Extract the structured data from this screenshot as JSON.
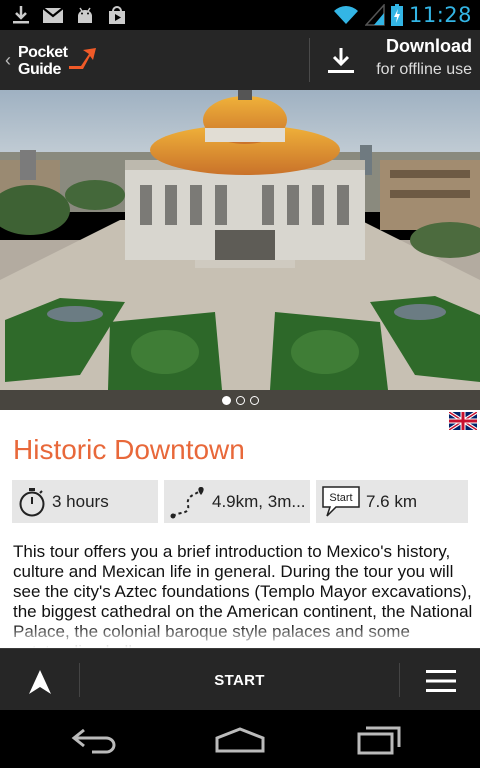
{
  "status_bar": {
    "time": "11:28",
    "left_icons": [
      "download-icon",
      "gmail-icon",
      "android-icon",
      "play-store-icon"
    ],
    "right_icons": [
      "wifi-icon",
      "signal-icon",
      "battery-icon"
    ],
    "accent_color": "#33b5e5"
  },
  "app_bar": {
    "logo_line1": "Pocket",
    "logo_line2": "Guide",
    "download_title": "Download",
    "download_subtitle": "for offline use"
  },
  "gallery": {
    "image_count": 3,
    "active_index": 0
  },
  "tour": {
    "language_flag": "uk-flag-icon",
    "title": "Historic Downtown",
    "title_color": "#e8683a",
    "duration": "3 hours",
    "route_distance": "4.9km, 3m...",
    "start_distance": "7.6 km",
    "start_badge": "Start",
    "description": "This tour offers you a brief introduction to Mexico's history, culture and Mexican life in general. During the tour you will see the city's Aztec foundations (Templo Mayor excavations), the biggest cathedral on the American continent, the National Palace, the colonial baroque style palaces and some outstanding belle"
  },
  "bottom_bar": {
    "start_label": "START"
  }
}
